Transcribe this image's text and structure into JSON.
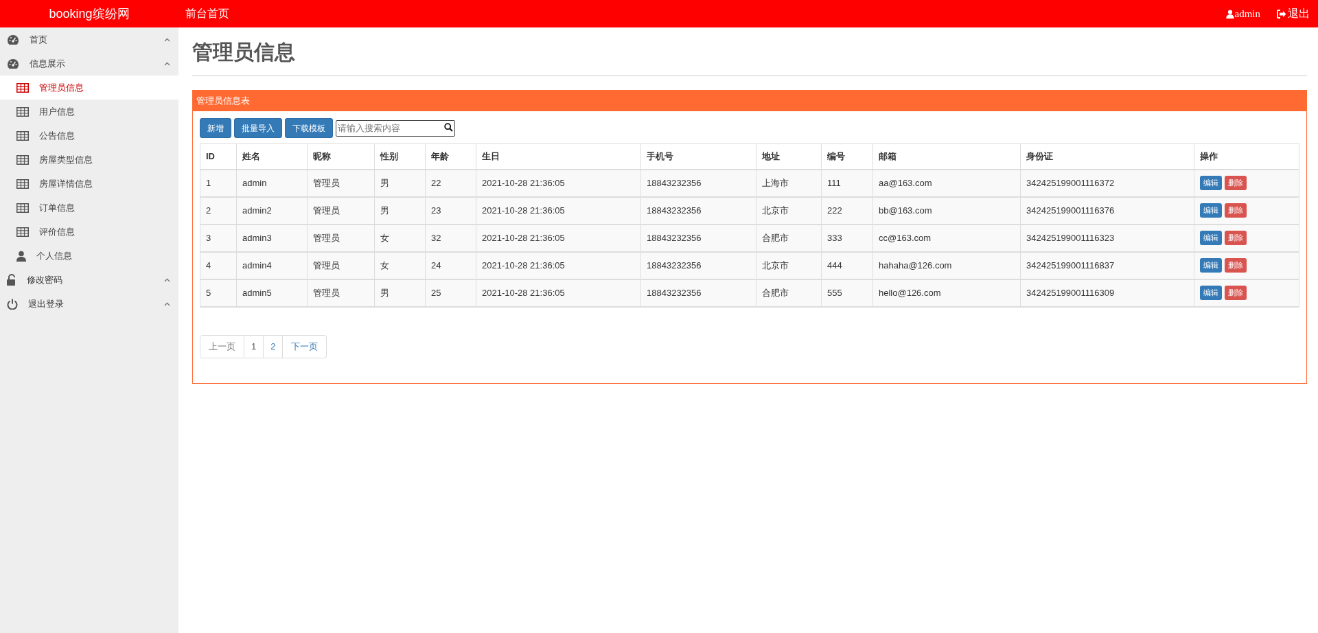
{
  "header": {
    "brand": "booking缤纷网",
    "nav_link": "前台首页",
    "user": "admin",
    "logout": "退出"
  },
  "sidebar": {
    "items": [
      {
        "label": "首页",
        "kind": "dashboard"
      },
      {
        "label": "信息展示",
        "kind": "dashboard",
        "children": [
          {
            "label": "管理员信息",
            "kind": "table",
            "selected": true
          },
          {
            "label": "用户信息",
            "kind": "table",
            "selected": false
          },
          {
            "label": "公告信息",
            "kind": "table",
            "selected": false
          },
          {
            "label": "房屋类型信息",
            "kind": "table",
            "selected": false
          },
          {
            "label": "房屋详情信息",
            "kind": "table",
            "selected": false
          },
          {
            "label": "订单信息",
            "kind": "table",
            "selected": false
          },
          {
            "label": "评价信息",
            "kind": "table",
            "selected": false
          },
          {
            "label": "个人信息",
            "kind": "person",
            "selected": false
          }
        ]
      },
      {
        "label": "修改密码",
        "kind": "lock"
      },
      {
        "label": "退出登录",
        "kind": "power"
      }
    ]
  },
  "page_title": "管理员信息",
  "panel": {
    "title": "管理员信息表",
    "toolbar": {
      "buttons": [
        "新增",
        "批量导入",
        "下载模板"
      ],
      "search": {
        "placeholder": "请输入搜索内容"
      }
    },
    "table": {
      "columns": [
        "ID",
        "姓名",
        "昵称",
        "性别",
        "年龄",
        "生日",
        "手机号",
        "地址",
        "编号",
        "邮箱",
        "身份证",
        "操作"
      ],
      "rows": [
        {
          "cells": [
            "1",
            "admin",
            "管理员",
            "男",
            "22",
            "2021-10-28 21:36:05",
            "18843232356",
            "上海市",
            "111",
            "aa@163.com",
            "342425199001116372"
          ],
          "actions": [
            "编辑",
            "删除"
          ]
        },
        {
          "cells": [
            "2",
            "admin2",
            "管理员",
            "男",
            "23",
            "2021-10-28 21:36:05",
            "18843232356",
            "北京市",
            "222",
            "bb@163.com",
            "342425199001116376"
          ],
          "actions": [
            "编辑",
            "删除"
          ]
        },
        {
          "cells": [
            "3",
            "admin3",
            "管理员",
            "女",
            "32",
            "2021-10-28 21:36:05",
            "18843232356",
            "合肥市",
            "333",
            "cc@163.com",
            "342425199001116323"
          ],
          "actions": [
            "编辑",
            "删除"
          ]
        },
        {
          "cells": [
            "4",
            "admin4",
            "管理员",
            "女",
            "24",
            "2021-10-28 21:36:05",
            "18843232356",
            "北京市",
            "444",
            "hahaha@126.com",
            "342425199001116837"
          ],
          "actions": [
            "编辑",
            "删除"
          ]
        },
        {
          "cells": [
            "5",
            "admin5",
            "管理员",
            "男",
            "25",
            "2021-10-28 21:36:05",
            "18843232356",
            "合肥市",
            "555",
            "hello@126.com",
            "342425199001116309"
          ],
          "actions": [
            "编辑",
            "删除"
          ]
        }
      ]
    },
    "pagination": {
      "prev": "上一页",
      "pages": [
        {
          "label": "1",
          "selected": true
        },
        {
          "label": "2",
          "selected": false
        }
      ],
      "next": "下一页"
    }
  }
}
